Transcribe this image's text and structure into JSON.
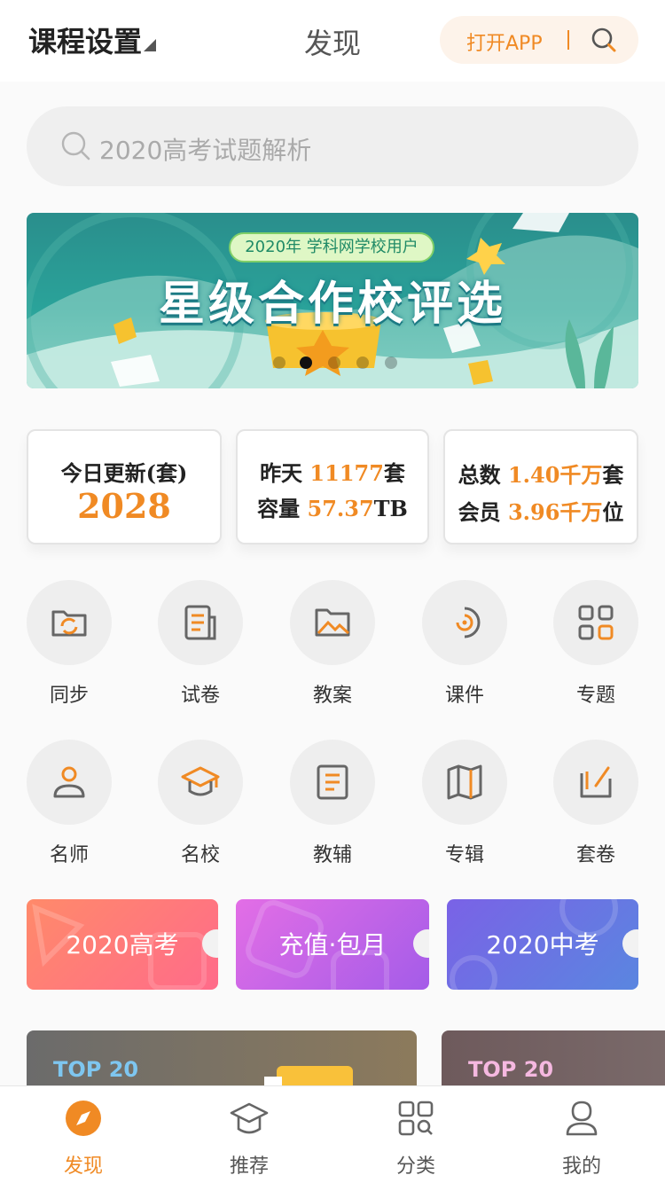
{
  "header": {
    "course_settings": "课程设置",
    "title": "发现",
    "open_app": "打开APP"
  },
  "search": {
    "placeholder": "2020高考试题解析"
  },
  "banner": {
    "subtitle": "2020年 学科网学校用户",
    "title": "星级合作校评选",
    "slide_count": 5,
    "active_slide": 2
  },
  "stats": {
    "today_label": "今日更新(套)",
    "today_value": "2028",
    "yesterday_label": "昨天",
    "yesterday_value": "11177",
    "yesterday_unit": "套",
    "capacity_label": "容量",
    "capacity_value": "57.37",
    "capacity_unit": "TB",
    "total_label": "总数",
    "total_value": "1.40千万",
    "total_unit": "套",
    "members_label": "会员",
    "members_value": "3.96千万",
    "members_unit": "位"
  },
  "categories": [
    {
      "label": "同步",
      "icon": "sync-folder-icon"
    },
    {
      "label": "试卷",
      "icon": "paper-icon"
    },
    {
      "label": "教案",
      "icon": "image-folder-icon"
    },
    {
      "label": "课件",
      "icon": "courseware-icon"
    },
    {
      "label": "专题",
      "icon": "topic-icon"
    },
    {
      "label": "名师",
      "icon": "teacher-icon"
    },
    {
      "label": "名校",
      "icon": "school-cap-icon"
    },
    {
      "label": "教辅",
      "icon": "tutoring-book-icon"
    },
    {
      "label": "专辑",
      "icon": "album-map-icon"
    },
    {
      "label": "套卷",
      "icon": "paper-set-icon"
    }
  ],
  "promos": [
    {
      "label": "2020高考",
      "color_from": "#ff8a6a",
      "color_to": "#ff6b8a"
    },
    {
      "label": "充值·包月",
      "color_from": "#e36ee6",
      "color_to": "#a45ce8"
    },
    {
      "label": "2020中考",
      "color_from": "#7a62e6",
      "color_to": "#5a86e0"
    }
  ],
  "top_cards": [
    {
      "label": "TOP 20",
      "label_color": "#7ec6f0"
    },
    {
      "label": "TOP 20",
      "label_color": "#f5b8e0"
    }
  ],
  "tabs": [
    {
      "label": "发现",
      "icon": "discover-icon",
      "active": true
    },
    {
      "label": "推荐",
      "icon": "graduation-cap-icon",
      "active": false
    },
    {
      "label": "分类",
      "icon": "category-grid-icon",
      "active": false
    },
    {
      "label": "我的",
      "icon": "profile-icon",
      "active": false
    }
  ],
  "colors": {
    "accent": "#f08a24",
    "icon_gray": "#666666"
  }
}
